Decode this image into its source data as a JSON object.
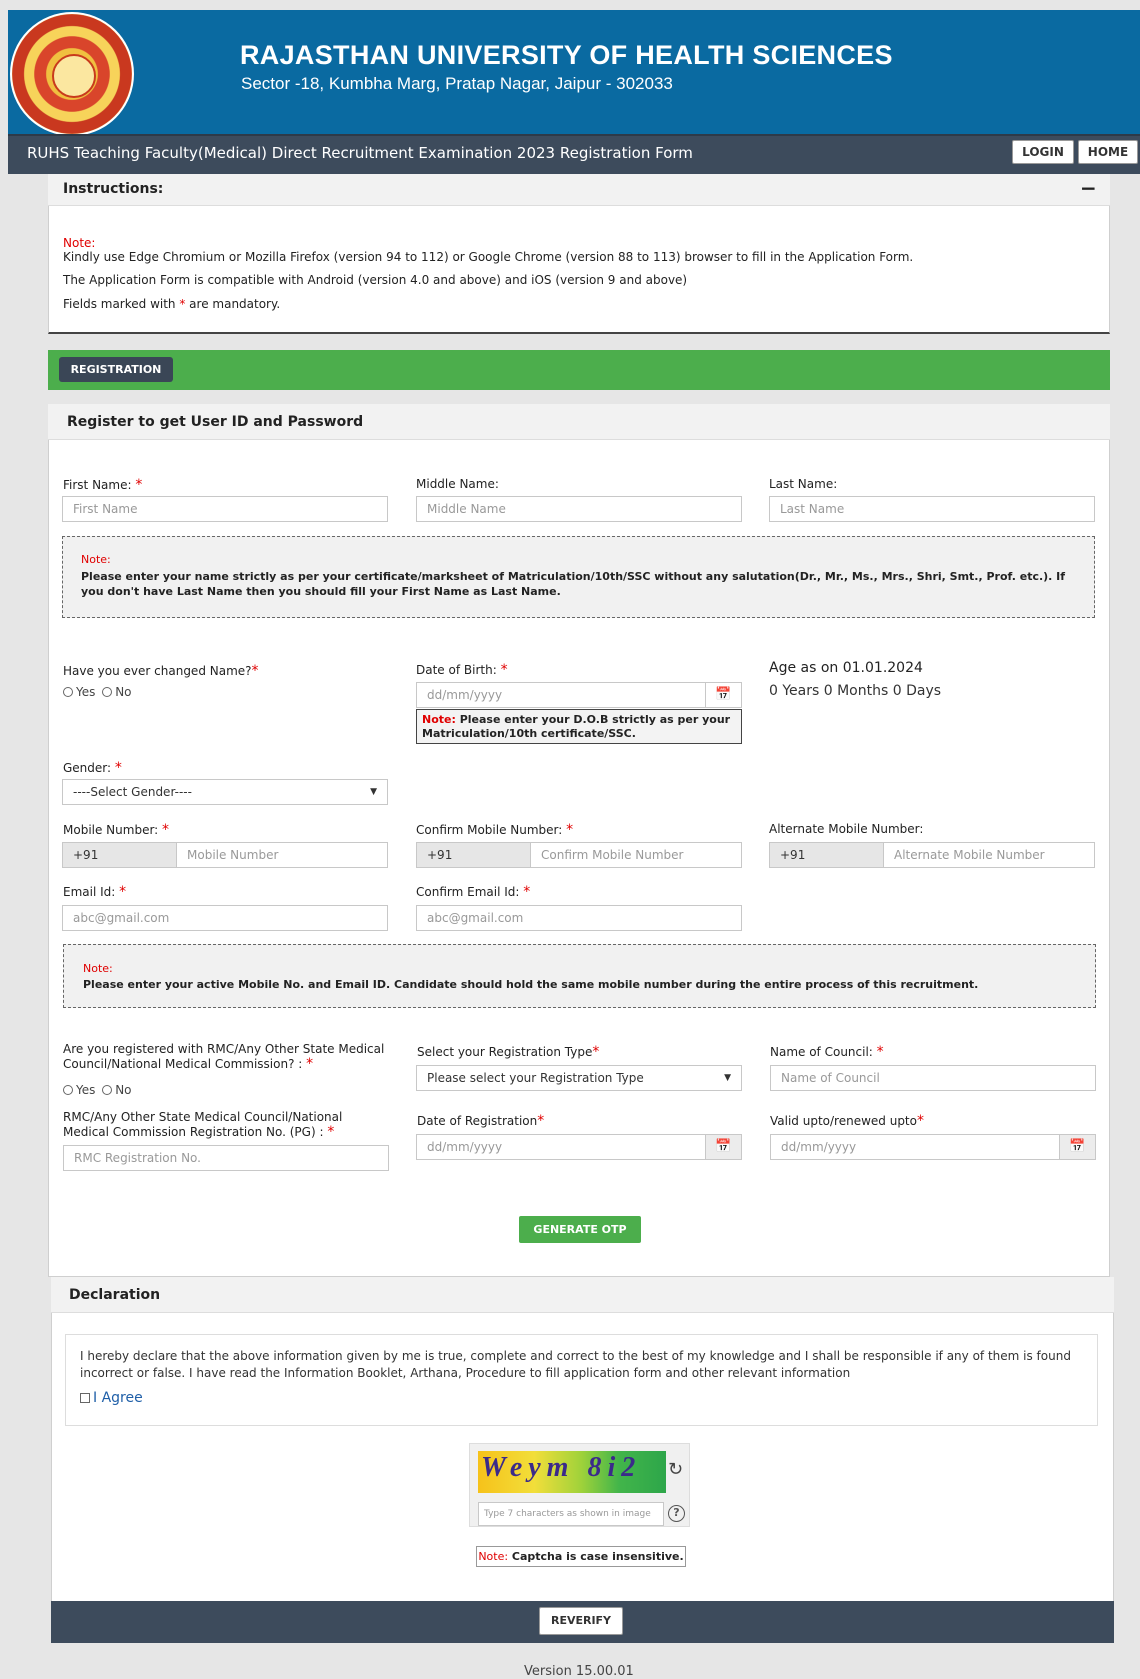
{
  "header": {
    "title": "RAJASTHAN UNIVERSITY OF HEALTH SCIENCES",
    "subtitle": "Sector -18, Kumbha Marg, Pratap Nagar, Jaipur - 302033"
  },
  "navbar": {
    "form_title": "RUHS Teaching Faculty(Medical) Direct Recruitment Examination 2023 Registration Form",
    "login": "LOGIN",
    "home": "HOME"
  },
  "instructions": {
    "title": "Instructions:",
    "collapse": "−",
    "note_label": "Note:",
    "line1": "Kindly use Edge Chromium or Mozilla Firefox (version 94 to 112) or Google Chrome (version 88 to 113) browser to fill in the Application Form.",
    "line2": "The Application Form is compatible with Android (version 4.0 and above) and iOS (version 9 and above)",
    "line3_a": "Fields marked with ",
    "line3_star": "*",
    "line3_b": " are mandatory."
  },
  "registration": {
    "tab": "REGISTRATION",
    "panel_title": "Register to get User ID and Password"
  },
  "name": {
    "first_label": "First Name:",
    "first_ph": "First Name",
    "middle_label": "Middle Name:",
    "middle_ph": "Middle Name",
    "last_label": "Last Name:",
    "last_ph": "Last Name",
    "note_label": "Note:",
    "note_text": "Please enter your name strictly as per your certificate/marksheet of Matriculation/10th/SSC without any salutation(Dr., Mr., Ms., Mrs., Shri, Smt., Prof. etc.). If you don't have Last Name then you should fill your First Name as Last Name."
  },
  "changed_name": {
    "label": "Have you ever changed Name?",
    "yes": "Yes",
    "no": "No"
  },
  "dob": {
    "label": "Date of Birth:",
    "placeholder": "dd/mm/yyyy",
    "note_label": "Note:",
    "note_text": " Please enter your D.O.B strictly as per your Matriculation/10th certificate/SSC."
  },
  "age": {
    "label": "Age as on 01.01.2024",
    "value": "0 Years 0 Months 0 Days"
  },
  "gender": {
    "label": "Gender:",
    "selected": "----Select Gender----"
  },
  "mobile": {
    "label": "Mobile Number:",
    "prefix": "+91",
    "placeholder": "Mobile Number",
    "confirm_label": "Confirm Mobile Number:",
    "confirm_placeholder": "Confirm Mobile Number",
    "alt_label": "Alternate Mobile Number:",
    "alt_placeholder": "Alternate Mobile Number"
  },
  "email": {
    "label": "Email Id:",
    "placeholder": "abc@gmail.com",
    "confirm_label": "Confirm Email Id:",
    "confirm_placeholder": "abc@gmail.com",
    "note_label": "Note:",
    "note_text": "Please enter your active Mobile No. and Email ID. Candidate should hold the same mobile number during the entire process of this recruitment."
  },
  "council": {
    "registered_label_1": "Are you registered with RMC/Any Other State Medical",
    "registered_label_2": "Council/National Medical Commission? :",
    "yes": "Yes",
    "no": "No",
    "type_label": "Select your Registration Type",
    "type_selected": "Please select your Registration Type",
    "name_label": "Name of Council:",
    "name_ph": "Name of Council",
    "regno_label_1": "RMC/Any Other State Medical Council/National",
    "regno_label_2": "Medical Commission Registration No. (PG) :",
    "regno_ph": "RMC Registration No.",
    "date_label": "Date of Registration",
    "date_ph": "dd/mm/yyyy",
    "valid_label": "Valid upto/renewed upto",
    "valid_ph": "dd/mm/yyyy"
  },
  "otp_button": "GENERATE OTP",
  "declaration": {
    "title": "Declaration",
    "text": "I hereby declare that the above information given by me is true, complete and correct to the best of my knowledge and I shall be responsible if any of them is found incorrect or false. I have read the Information Booklet, Arthana, Procedure to fill application form and other relevant information",
    "agree": "I Agree"
  },
  "captcha": {
    "image_text": "Weym 8i2",
    "placeholder": "Type 7 characters as shown in image",
    "note_label": "Note:",
    "note_text": " Captcha is case insensitive."
  },
  "reverify": "REVERIFY",
  "version": "Version 15.00.01",
  "colors": {
    "header_blue": "#0a6aa1",
    "nav_dark": "#3d4b5c",
    "green": "#4cae4c",
    "required_red": "#e00000"
  },
  "icons": [
    "calendar-icon",
    "dropdown-caret-icon",
    "refresh-icon",
    "help-icon"
  ]
}
